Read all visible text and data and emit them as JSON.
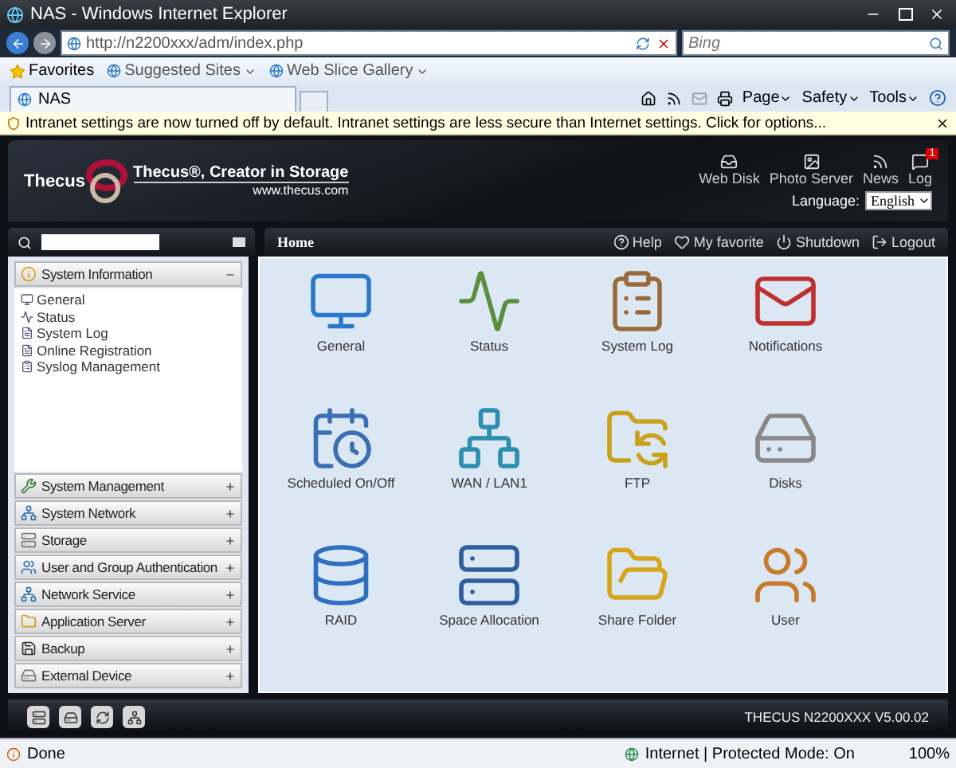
{
  "window": {
    "title": "NAS - Windows Internet Explorer"
  },
  "address_bar": {
    "url": "http://n2200xxx/adm/index.php"
  },
  "search": {
    "placeholder": "Bing"
  },
  "favorites_bar": {
    "label": "Favorites",
    "links": [
      {
        "label": "Suggested Sites"
      },
      {
        "label": "Web Slice Gallery"
      }
    ]
  },
  "tabs": [
    {
      "label": "NAS",
      "selected": true
    }
  ],
  "command_bar": [
    "Page",
    "Safety",
    "Tools"
  ],
  "info_bar": {
    "message": "Intranet settings are now turned off by default. Intranet settings are less secure than Internet settings. Click for options..."
  },
  "header": {
    "logo": "Thecus",
    "tagline": "Thecus®, Creator in Storage",
    "website": "www.thecus.com",
    "links": [
      {
        "label": "Web Disk"
      },
      {
        "label": "Photo Server"
      },
      {
        "label": "News"
      },
      {
        "label": "Log",
        "badge": "1"
      }
    ],
    "language_label": "Language:",
    "language": "English"
  },
  "nav": {
    "breadcrumb": "Home",
    "actions": [
      "Help",
      "My favorite",
      "Shutdown",
      "Logout"
    ]
  },
  "sidebar": {
    "sections": [
      {
        "label": "System Information",
        "expanded": true,
        "children": [
          "General",
          "Status",
          "System Log",
          "Online Registration",
          "Syslog Management"
        ]
      },
      {
        "label": "System Management",
        "expanded": false
      },
      {
        "label": "System Network",
        "expanded": false
      },
      {
        "label": "Storage",
        "expanded": false
      },
      {
        "label": "User and Group Authentication",
        "expanded": false
      },
      {
        "label": "Network Service",
        "expanded": false
      },
      {
        "label": "Application Server",
        "expanded": false
      },
      {
        "label": "Backup",
        "expanded": false
      },
      {
        "label": "External Device",
        "expanded": false
      }
    ]
  },
  "grid": [
    {
      "label": "General"
    },
    {
      "label": "Status"
    },
    {
      "label": "System Log"
    },
    {
      "label": "Notifications"
    },
    {
      "label": "Scheduled On/Off"
    },
    {
      "label": "WAN / LAN1"
    },
    {
      "label": "FTP"
    },
    {
      "label": "Disks"
    },
    {
      "label": "RAID"
    },
    {
      "label": "Space Allocation"
    },
    {
      "label": "Share Folder"
    },
    {
      "label": "User"
    }
  ],
  "footer": {
    "version": "THECUS N2200XXX V5.00.02"
  },
  "status_bar": {
    "status": "Done",
    "zone": "Internet | Protected Mode: On",
    "zoom": "100%"
  }
}
